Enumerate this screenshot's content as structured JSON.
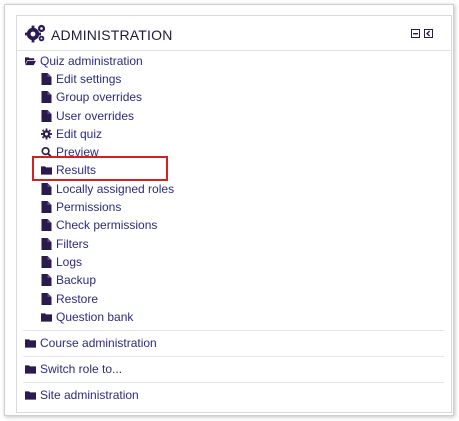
{
  "block": {
    "title": "ADMINISTRATION",
    "controls": [
      "minimize-icon",
      "dock-icon"
    ]
  },
  "quiz_admin": {
    "label": "Quiz administration",
    "icon": "folder-open-icon",
    "items": [
      {
        "label": "Edit settings",
        "icon": "file-icon"
      },
      {
        "label": "Group overrides",
        "icon": "file-icon"
      },
      {
        "label": "User overrides",
        "icon": "file-icon"
      },
      {
        "label": "Edit quiz",
        "icon": "gear-icon"
      },
      {
        "label": "Preview",
        "icon": "search-icon"
      },
      {
        "label": "Results",
        "icon": "folder-icon"
      },
      {
        "label": "Locally assigned roles",
        "icon": "file-icon"
      },
      {
        "label": "Permissions",
        "icon": "file-icon"
      },
      {
        "label": "Check permissions",
        "icon": "file-icon"
      },
      {
        "label": "Filters",
        "icon": "file-icon"
      },
      {
        "label": "Logs",
        "icon": "file-icon"
      },
      {
        "label": "Backup",
        "icon": "file-icon"
      },
      {
        "label": "Restore",
        "icon": "file-icon"
      },
      {
        "label": "Question bank",
        "icon": "folder-icon"
      }
    ]
  },
  "sections": [
    {
      "label": "Course administration",
      "icon": "folder-icon"
    },
    {
      "label": "Switch role to...",
      "icon": "folder-icon"
    },
    {
      "label": "Site administration",
      "icon": "folder-icon"
    }
  ],
  "colors": {
    "link": "#2b2b80",
    "icon": "#2a1a4d",
    "highlight": "#d62020"
  }
}
